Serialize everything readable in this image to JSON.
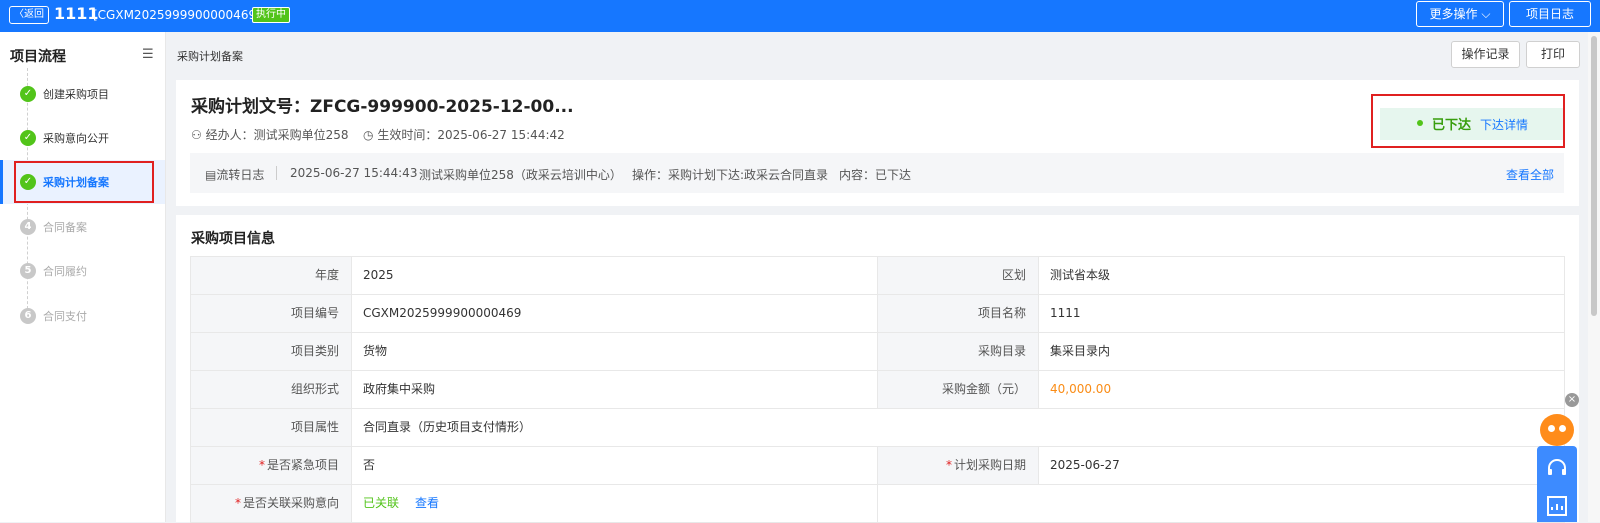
{
  "header": {
    "back_label": "〈返回",
    "project_number": "1111",
    "project_code": "[CGXM2025999900000469]",
    "status_badge": "执行中",
    "more_actions_label": "更多操作",
    "project_log_label": "项目日志"
  },
  "sidebar": {
    "title": "项目流程",
    "steps": [
      {
        "label": "创建采购项目",
        "state": "done",
        "icon": "check-icon"
      },
      {
        "label": "采购意向公开",
        "state": "done",
        "icon": "check-icon"
      },
      {
        "label": "采购计划备案",
        "state": "active",
        "icon": "check-icon"
      },
      {
        "label": "合同备案",
        "state": "pending",
        "number": "4"
      },
      {
        "label": "合同履约",
        "state": "pending",
        "number": "5"
      },
      {
        "label": "合同支付",
        "state": "pending",
        "number": "6"
      }
    ]
  },
  "breadcrumb": "采购计划备案",
  "toolbar": {
    "operation_record_label": "操作记录",
    "print_label": "打印"
  },
  "plan": {
    "title": "采购计划文号：ZFCG-999900-2025-12-00...",
    "handler": "经办人：测试采购单位258",
    "effective_time": "生效时间：2025-06-27 15:44:42",
    "status": "已下达",
    "status_link": "下达详情"
  },
  "flow_log": {
    "label": "流转日志",
    "time": "2025-06-27 15:44:43",
    "unit": "测试采购单位258（政采云培训中心）",
    "operation": "操作：采购计划下达:政采云合同直录",
    "content": "内容：已下达",
    "view_all": "查看全部"
  },
  "info_section": {
    "title": "采购项目信息",
    "rows": [
      {
        "l1": "年度",
        "v1": "2025",
        "l2": "区划",
        "v2": "测试省本级"
      },
      {
        "l1": "项目编号",
        "v1": "CGXM2025999900000469",
        "l2": "项目名称",
        "v2": "1111"
      },
      {
        "l1": "项目类别",
        "v1": "货物",
        "l2": "采购目录",
        "v2": "集采目录内"
      },
      {
        "l1": "组织形式",
        "v1": "政府集中采购",
        "l2": "采购金额（元）",
        "v2": "40,000.00"
      },
      {
        "l1": "项目属性",
        "v1": "合同直录（历史项目支付情形）"
      },
      {
        "l1": "是否紧急项目",
        "v1": "否",
        "l2": "计划采购日期",
        "v2": "2025-06-27"
      },
      {
        "l1": "是否关联采购意向",
        "v1": "已关联",
        "link": "查看"
      }
    ]
  },
  "colors": {
    "primary": "#1677ff",
    "success": "#52c41a",
    "amount": "#fa8c16",
    "highlight_outline": "#e02020"
  }
}
